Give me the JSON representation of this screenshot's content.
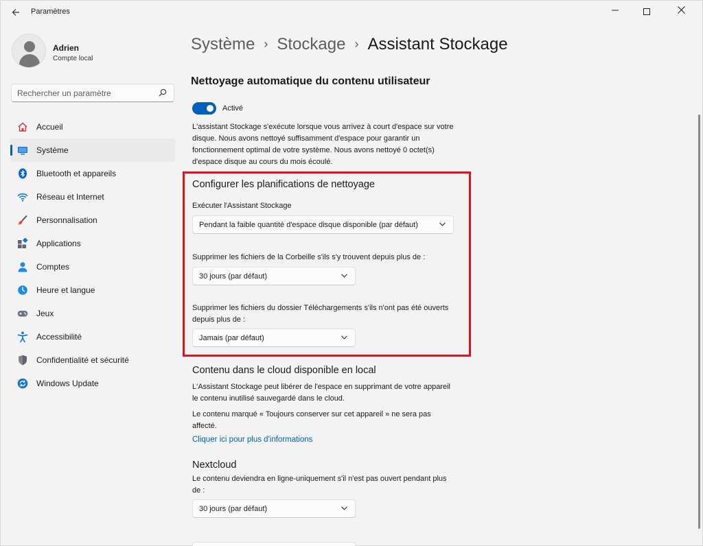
{
  "window": {
    "title": "Paramètres"
  },
  "profile": {
    "name": "Adrien",
    "account_type": "Compte local"
  },
  "search": {
    "placeholder": "Rechercher un paramètre"
  },
  "sidebar": {
    "items": [
      {
        "label": "Accueil",
        "icon": "home-icon",
        "active": false
      },
      {
        "label": "Système",
        "icon": "system-icon",
        "active": true
      },
      {
        "label": "Bluetooth et appareils",
        "icon": "bluetooth-icon",
        "active": false
      },
      {
        "label": "Réseau et Internet",
        "icon": "wifi-icon",
        "active": false
      },
      {
        "label": "Personnalisation",
        "icon": "brush-icon",
        "active": false
      },
      {
        "label": "Applications",
        "icon": "apps-icon",
        "active": false
      },
      {
        "label": "Comptes",
        "icon": "account-icon",
        "active": false
      },
      {
        "label": "Heure et langue",
        "icon": "clock-globe-icon",
        "active": false
      },
      {
        "label": "Jeux",
        "icon": "gamepad-icon",
        "active": false
      },
      {
        "label": "Accessibilité",
        "icon": "accessibility-icon",
        "active": false
      },
      {
        "label": "Confidentialité et sécurité",
        "icon": "shield-icon",
        "active": false
      },
      {
        "label": "Windows Update",
        "icon": "update-icon",
        "active": false
      }
    ]
  },
  "breadcrumb": {
    "level1": "Système",
    "level2": "Stockage",
    "current": "Assistant Stockage"
  },
  "auto_cleanup": {
    "heading": "Nettoyage automatique du contenu utilisateur",
    "toggle_state": "Activé",
    "description": "L'assistant Stockage s'exécute lorsque vous arrivez à court d'espace sur votre disque. Nous avons nettoyé suffisamment d'espace pour garantir un fonctionnement optimal de votre système. Nous avons nettoyé 0 octet(s) d'espace disque au cours du mois écoulé."
  },
  "schedules": {
    "heading": "Configurer les planifications de nettoyage",
    "run_label": "Exécuter l'Assistant Stockage",
    "run_value": "Pendant la faible quantité d'espace disque disponible (par défaut)",
    "recycle_label": "Supprimer les fichiers de la Corbeille s'ils s'y trouvent depuis plus de :",
    "recycle_value": "30 jours (par défaut)",
    "downloads_label": "Supprimer les fichiers du dossier Téléchargements s'ils n'ont pas été ouverts depuis plus de :",
    "downloads_value": "Jamais (par défaut)"
  },
  "cloud": {
    "heading": "Contenu dans le cloud disponible en local",
    "description": "L'Assistant Stockage peut libérer de l'espace en supprimant de votre appareil le contenu inutilisé sauvegardé dans le cloud.",
    "note": "Le contenu marqué « Toujours conserver sur cet appareil » ne sera pas affecté.",
    "link": "Cliquer ici pour plus d'informations"
  },
  "nextcloud": {
    "heading": "Nextcloud",
    "description": "Le contenu deviendra en ligne-uniquement s'il n'est pas ouvert pendant plus de :",
    "value": "30 jours (par défaut)"
  },
  "colors": {
    "accent": "#005fb8",
    "highlight_border": "#e3101e",
    "background": "#f3f3f3"
  }
}
